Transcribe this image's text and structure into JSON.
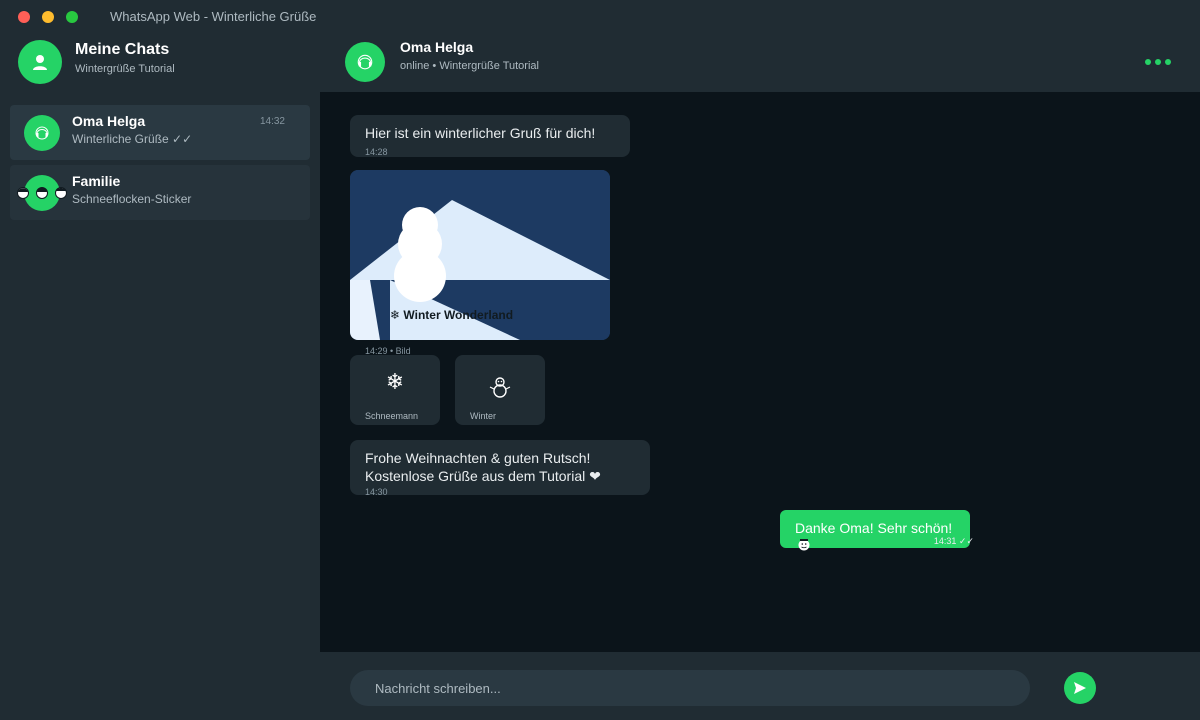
{
  "window": {
    "title": "WhatsApp Web - Winterliche Grüße"
  },
  "sidebar": {
    "title": "Meine Chats",
    "subtitle": "Wintergrüße Tutorial",
    "chats": [
      {
        "name": "Oma Helga",
        "preview": "Winterliche Grüße ✓✓",
        "time": "14:32",
        "avatar_icon": "headphones-icon"
      },
      {
        "name": "Familie",
        "preview": "Schneeflocken-Sticker",
        "avatar_icon": "family-faces-icon"
      }
    ]
  },
  "chat_header": {
    "name": "Oma Helga",
    "status": "online • Wintergrüße Tutorial",
    "menu_icon": "more-dots-icon"
  },
  "messages": [
    {
      "type": "incoming",
      "text": "Hier ist ein winterlicher Gruß für dich!",
      "time": "14:28"
    },
    {
      "type": "image",
      "caption": "❄ Winter Wonderland",
      "time": "14:29 • Bild"
    },
    {
      "type": "sticker",
      "icon": "snowflake-icon",
      "glyph": "❄",
      "label": "Schneemann"
    },
    {
      "type": "sticker",
      "icon": "snowman-icon",
      "label": "Winter"
    },
    {
      "type": "incoming",
      "line1": "Frohe Weihnachten & guten Rutsch!",
      "line2": "Kostenlose Grüße aus dem Tutorial ❤",
      "time": "14:30"
    },
    {
      "type": "outgoing",
      "text": "Danke Oma! Sehr schön!",
      "time": "14:31 ✓✓"
    }
  ],
  "composer": {
    "placeholder": "Nachricht schreiben..."
  },
  "colors": {
    "accent": "#25d366",
    "panel": "#202c33",
    "background": "#0b141a",
    "image_sky": "#1d3a62"
  }
}
